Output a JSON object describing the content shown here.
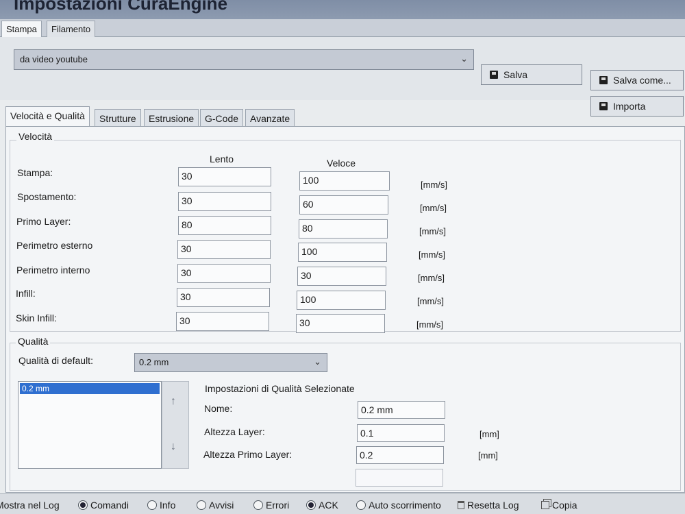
{
  "window": {
    "title": "Impostazioni CuraEngine"
  },
  "top_tabs": [
    "Stampa",
    "Filamento"
  ],
  "profile": {
    "selected": "da video youtube",
    "save_label": "Salva",
    "save_as_label": "Salva come...",
    "import_label": "Importa"
  },
  "inner_tabs": [
    "Velocità e Qualità",
    "Strutture",
    "Estrusione",
    "G-Code",
    "Avanzate"
  ],
  "speed": {
    "group_title": "Velocità",
    "col_slow": "Lento",
    "col_fast": "Veloce",
    "rows": [
      {
        "label": "Stampa:",
        "slow": "30",
        "fast": "100",
        "unit": "[mm/s]"
      },
      {
        "label": "Spostamento:",
        "slow": "30",
        "fast": "60",
        "unit": "[mm/s]"
      },
      {
        "label": "Primo Layer:",
        "slow": "80",
        "fast": "80",
        "unit": "[mm/s]"
      },
      {
        "label": "Perimetro esterno",
        "slow": "30",
        "fast": "100",
        "unit": "[mm/s]"
      },
      {
        "label": "Perimetro interno",
        "slow": "30",
        "fast": "30",
        "unit": "[mm/s]"
      },
      {
        "label": "Infill:",
        "slow": "30",
        "fast": "100",
        "unit": "[mm/s]"
      },
      {
        "label": "Skin Infill:",
        "slow": "30",
        "fast": "30",
        "unit": "[mm/s]"
      }
    ]
  },
  "quality": {
    "group_title": "Qualità",
    "default_label": "Qualità di default:",
    "default_value": "0.2 mm",
    "list_items": [
      "0.2 mm"
    ],
    "selected_title": "Impostazioni di Qualità Selezionate",
    "fields": [
      {
        "label": "Nome:",
        "value": "0.2 mm",
        "unit": ""
      },
      {
        "label": "Altezza Layer:",
        "value": "0.1",
        "unit": "[mm]"
      },
      {
        "label": "Altezza Primo Layer:",
        "value": "0.2",
        "unit": "[mm]"
      }
    ]
  },
  "statusbar": {
    "log_label": "Mostra nel Log",
    "options": [
      {
        "label": "Comandi",
        "checked": true
      },
      {
        "label": "Info",
        "checked": false
      },
      {
        "label": "Avvisi",
        "checked": false
      },
      {
        "label": "Errori",
        "checked": false
      },
      {
        "label": "ACK",
        "checked": true
      },
      {
        "label": "Auto scorrimento",
        "checked": false
      }
    ],
    "reset_label": "Resetta Log",
    "copy_label": "Copia"
  }
}
